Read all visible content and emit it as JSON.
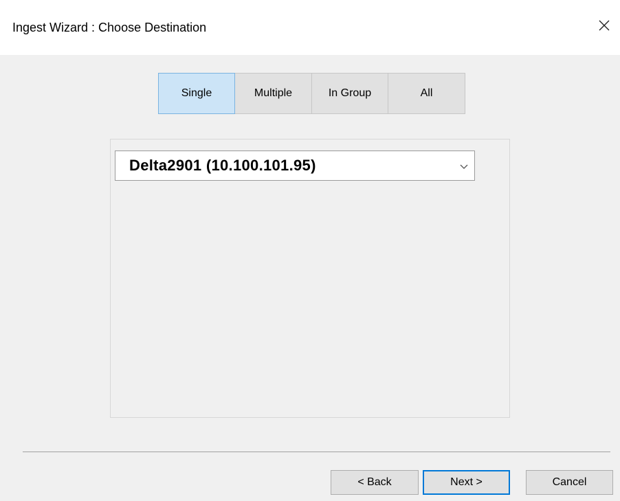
{
  "window": {
    "title": "Ingest Wizard : Choose Destination"
  },
  "tabs": [
    {
      "label": "Single",
      "active": true
    },
    {
      "label": "Multiple",
      "active": false
    },
    {
      "label": "In Group",
      "active": false
    },
    {
      "label": "All",
      "active": false
    }
  ],
  "destination": {
    "selected": "Delta2901  (10.100.101.95)"
  },
  "buttons": {
    "back": "< Back",
    "next": "Next >",
    "cancel": "Cancel"
  },
  "colors": {
    "active_tab": "#cce4f7",
    "focus_border": "#0078d7"
  },
  "icons": {
    "close": "close-icon",
    "dropdown": "chevron-down-icon"
  }
}
